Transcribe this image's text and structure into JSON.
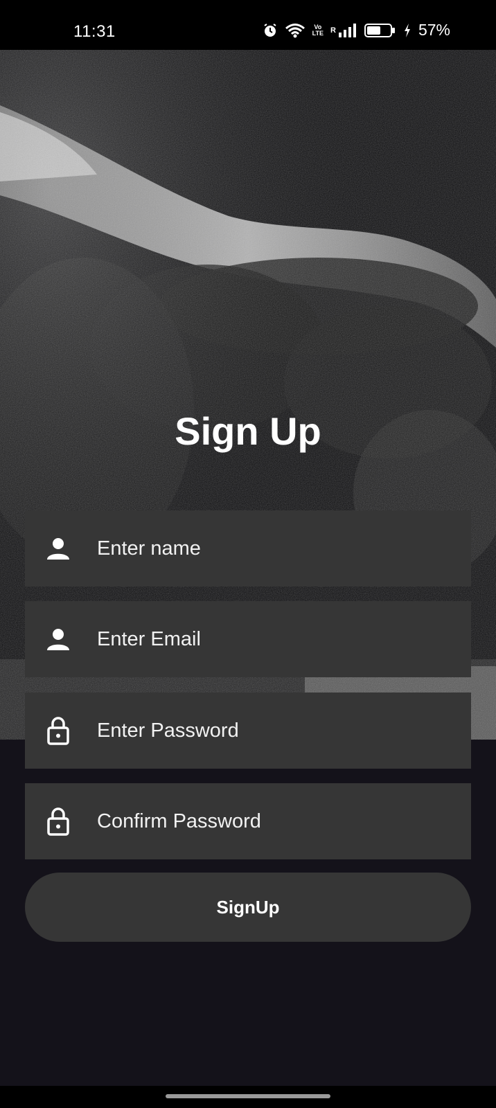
{
  "status_bar": {
    "time": "11:31",
    "battery_percent": "57%",
    "volte_line1": "Vo",
    "volte_line2": "LTE",
    "roaming": "R",
    "icons": [
      "alarm-icon",
      "wifi-icon",
      "volte-icon",
      "signal-icon",
      "battery-icon",
      "charging-icon"
    ]
  },
  "hero": {
    "description_icon": "background-photo"
  },
  "form": {
    "title": "Sign Up",
    "fields": [
      {
        "icon": "person-icon",
        "placeholder": "Enter name"
      },
      {
        "icon": "person-icon",
        "placeholder": "Enter Email"
      },
      {
        "icon": "lock-icon",
        "placeholder": "Enter Password"
      },
      {
        "icon": "lock-icon",
        "placeholder": "Confirm Password"
      }
    ],
    "submit_label": "SignUp"
  },
  "colors": {
    "background": "#14121a",
    "field": "#363636",
    "text": "#ffffff"
  }
}
